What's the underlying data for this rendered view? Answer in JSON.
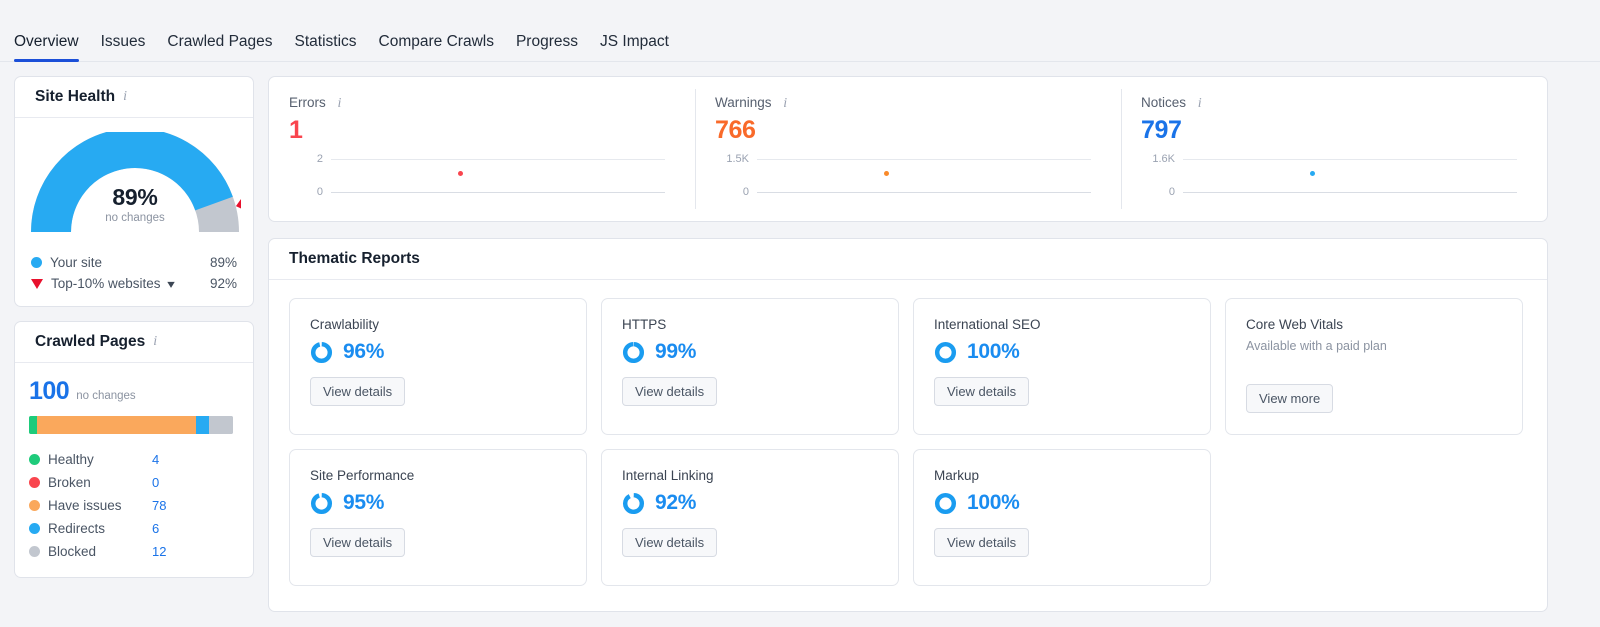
{
  "tabs": [
    {
      "label": "Overview",
      "active": true
    },
    {
      "label": "Issues",
      "active": false
    },
    {
      "label": "Crawled Pages",
      "active": false
    },
    {
      "label": "Statistics",
      "active": false
    },
    {
      "label": "Compare Crawls",
      "active": false
    },
    {
      "label": "Progress",
      "active": false
    },
    {
      "label": "JS Impact",
      "active": false
    }
  ],
  "site_health": {
    "title": "Site Health",
    "gauge_value": "89%",
    "gauge_sub": "no changes",
    "gauge_percent": 89,
    "benchmark_percent": 92,
    "legend": [
      {
        "marker": "circle",
        "color": "#27aaf2",
        "label": "Your site",
        "value": "89%"
      },
      {
        "marker": "triangle",
        "color": "#e8112d",
        "label": "Top-10% websites",
        "value": "92%",
        "has_chevron": true
      }
    ]
  },
  "crawled_pages": {
    "title": "Crawled Pages",
    "total": "100",
    "total_sub": "no changes",
    "segments": [
      {
        "label": "Healthy",
        "value": "4",
        "pct": 4,
        "color": "#1ecb7b"
      },
      {
        "label": "Broken",
        "value": "0",
        "pct": 0,
        "color": "#f9454e"
      },
      {
        "label": "Have issues",
        "value": "78",
        "pct": 78,
        "color": "#faa85c"
      },
      {
        "label": "Redirects",
        "value": "6",
        "pct": 6,
        "color": "#27aaf2"
      },
      {
        "label": "Blocked",
        "value": "12",
        "pct": 12,
        "color": "#c2c7cf"
      }
    ]
  },
  "stats": [
    {
      "label": "Errors",
      "value": "1",
      "color": "#f9454e",
      "axis_top": "2",
      "axis_bottom": "0",
      "dot_color": "#f9454e",
      "dot_x_pct": 44,
      "dot_y_pct": 50
    },
    {
      "label": "Warnings",
      "value": "766",
      "color": "#f96a2a",
      "axis_top": "1.5K",
      "axis_bottom": "0",
      "dot_color": "#f98a2a",
      "dot_x_pct": 44,
      "dot_y_pct": 50
    },
    {
      "label": "Notices",
      "value": "797",
      "color": "#1a73e8",
      "axis_top": "1.6K",
      "axis_bottom": "0",
      "dot_color": "#27aaf2",
      "dot_x_pct": 44,
      "dot_y_pct": 50
    }
  ],
  "thematic": {
    "title": "Thematic Reports",
    "cards": [
      {
        "name": "Crawlability",
        "percent": "96%",
        "value": 96,
        "button": "View details",
        "paid": false
      },
      {
        "name": "HTTPS",
        "percent": "99%",
        "value": 99,
        "button": "View details",
        "paid": false
      },
      {
        "name": "International SEO",
        "percent": "100%",
        "value": 100,
        "button": "View details",
        "paid": false
      },
      {
        "name": "Core Web Vitals",
        "subtitle": "Available with a paid plan",
        "button": "View more",
        "paid": true
      },
      {
        "name": "Site Performance",
        "percent": "95%",
        "value": 95,
        "button": "View details",
        "paid": false
      },
      {
        "name": "Internal Linking",
        "percent": "92%",
        "value": 92,
        "button": "View details",
        "paid": false
      },
      {
        "name": "Markup",
        "percent": "100%",
        "value": 100,
        "button": "View details",
        "paid": false
      }
    ]
  },
  "colors": {
    "accent_blue": "#1a73e8",
    "ring_blue": "#1a9cf0",
    "gauge_blue": "#27aaf2",
    "gauge_gray": "#c2c7cf",
    "red": "#e8112d",
    "page_bg": "#f3f4f7"
  }
}
